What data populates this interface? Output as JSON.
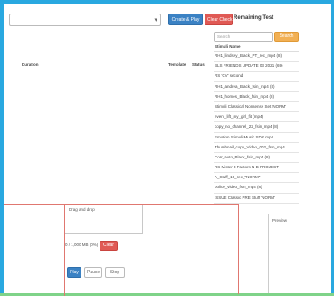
{
  "toolbar": {
    "select_value": "",
    "create_play_label": "Create & Play",
    "clear_check_label": "Clear Check"
  },
  "table": {
    "columns": [
      "Duration",
      "Template",
      "Status"
    ]
  },
  "remaining": {
    "heading": "Remaining Test",
    "search_placeholder": "Search",
    "search_button_label": "Search",
    "list_header": "Stimuli Name",
    "items": [
      "RH1_lindsey_Black_PT_rec_mp4 (8)",
      "BLS FRIENDS UPDATE 03 2021 (69)",
      "RS 'CV' second",
      "RH1_andrea_Black_fsin_mp4 (8)",
      "RH1_homes_Black_fsin_mp4 (8)",
      "Stimuli Classical Nonsense Set 'NORM'",
      "event_lift_my_girl_fit (mp4)",
      "copy_no_channel_22_fsin_mp4 (8)",
      "Emotion Stimuli Music SDR mp4",
      "Thumbnail_copy_Video_002_fsin_mp4",
      "Corr_auto_Black_fsin_mp4 (8)",
      "RS Mister 3 Factors N-B PROJECT",
      "A_Stuff_10_rec_\"NORM\"",
      "police_video_fsin_mp4 (8)",
      "ISSUE Classic PRE Stuff 'NORM'"
    ]
  },
  "upload": {
    "drop_label": "Drag and drop",
    "status_text": "0 / 1,000 MB (0%)",
    "clear_label": "Clear",
    "btn_play": "Play",
    "btn_pause": "Pause",
    "btn_stop": "Stop"
  },
  "preview": {
    "label": "Preview"
  }
}
